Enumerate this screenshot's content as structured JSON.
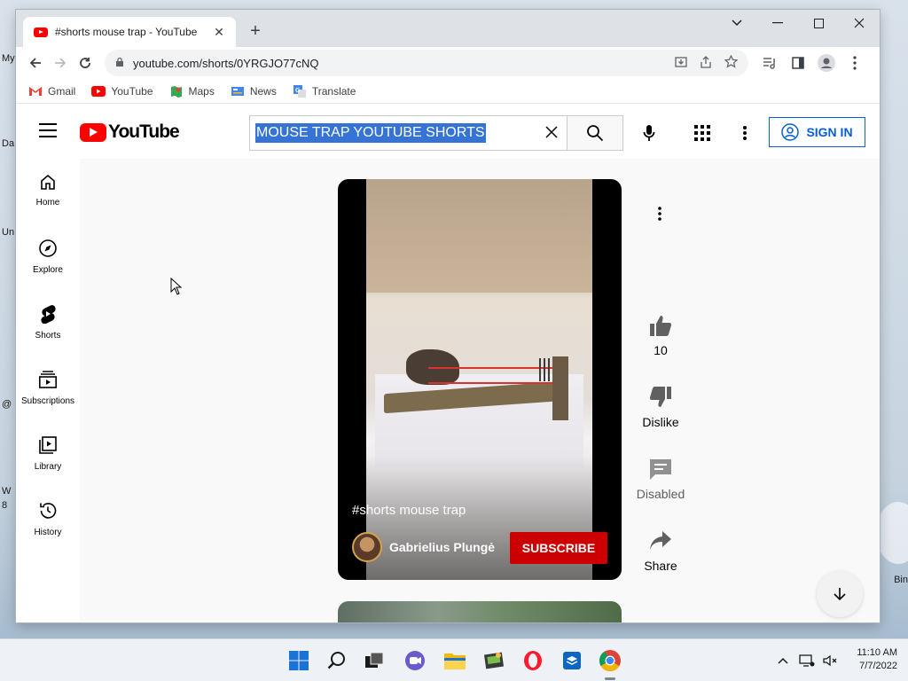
{
  "desktop": {
    "left_labels": [
      "My",
      "Da",
      "Un",
      "@",
      "W",
      "8"
    ],
    "right_label": "Bin"
  },
  "browser": {
    "tab_title": "#shorts mouse trap - YouTube",
    "new_tab_label": "+",
    "url": "youtube.com/shorts/0YRGJO77cNQ",
    "bookmarks": [
      {
        "label": "Gmail",
        "icon": "gmail-icon",
        "color": "#ea4335"
      },
      {
        "label": "YouTube",
        "icon": "youtube-icon",
        "color": "#ff0000"
      },
      {
        "label": "Maps",
        "icon": "maps-icon",
        "color": "#34a853"
      },
      {
        "label": "News",
        "icon": "news-icon",
        "color": "#4285f4"
      },
      {
        "label": "Translate",
        "icon": "translate-icon",
        "color": "#4285f4"
      }
    ]
  },
  "youtube": {
    "logo_text": "YouTube",
    "search_query": "MOUSE TRAP YOUTUBE SHORTS",
    "sign_in_label": "SIGN IN",
    "sidebar": [
      {
        "label": "Home",
        "icon": "home-icon"
      },
      {
        "label": "Explore",
        "icon": "explore-icon"
      },
      {
        "label": "Shorts",
        "icon": "shorts-icon"
      },
      {
        "label": "Subscriptions",
        "icon": "subscriptions-icon"
      },
      {
        "label": "Library",
        "icon": "library-icon"
      },
      {
        "label": "History",
        "icon": "history-icon"
      }
    ],
    "short": {
      "title": "#shorts mouse trap",
      "channel": "Gabrielius Plungė",
      "subscribe_label": "SUBSCRIBE"
    },
    "actions": {
      "like_count": "10",
      "dislike_label": "Dislike",
      "comments_label": "Disabled",
      "share_label": "Share"
    },
    "colors": {
      "brand_red": "#ff0000",
      "subscribe_red": "#cc0000",
      "link_blue": "#065fd4",
      "selection_blue": "#3574d4"
    }
  },
  "taskbar": {
    "time": "11:10 AM",
    "date": "7/7/2022",
    "apps": [
      "start-icon",
      "search-icon",
      "task-view-icon",
      "chat-icon",
      "file-explorer-icon",
      "app-icon",
      "opera-icon",
      "store-icon",
      "chrome-icon"
    ]
  }
}
